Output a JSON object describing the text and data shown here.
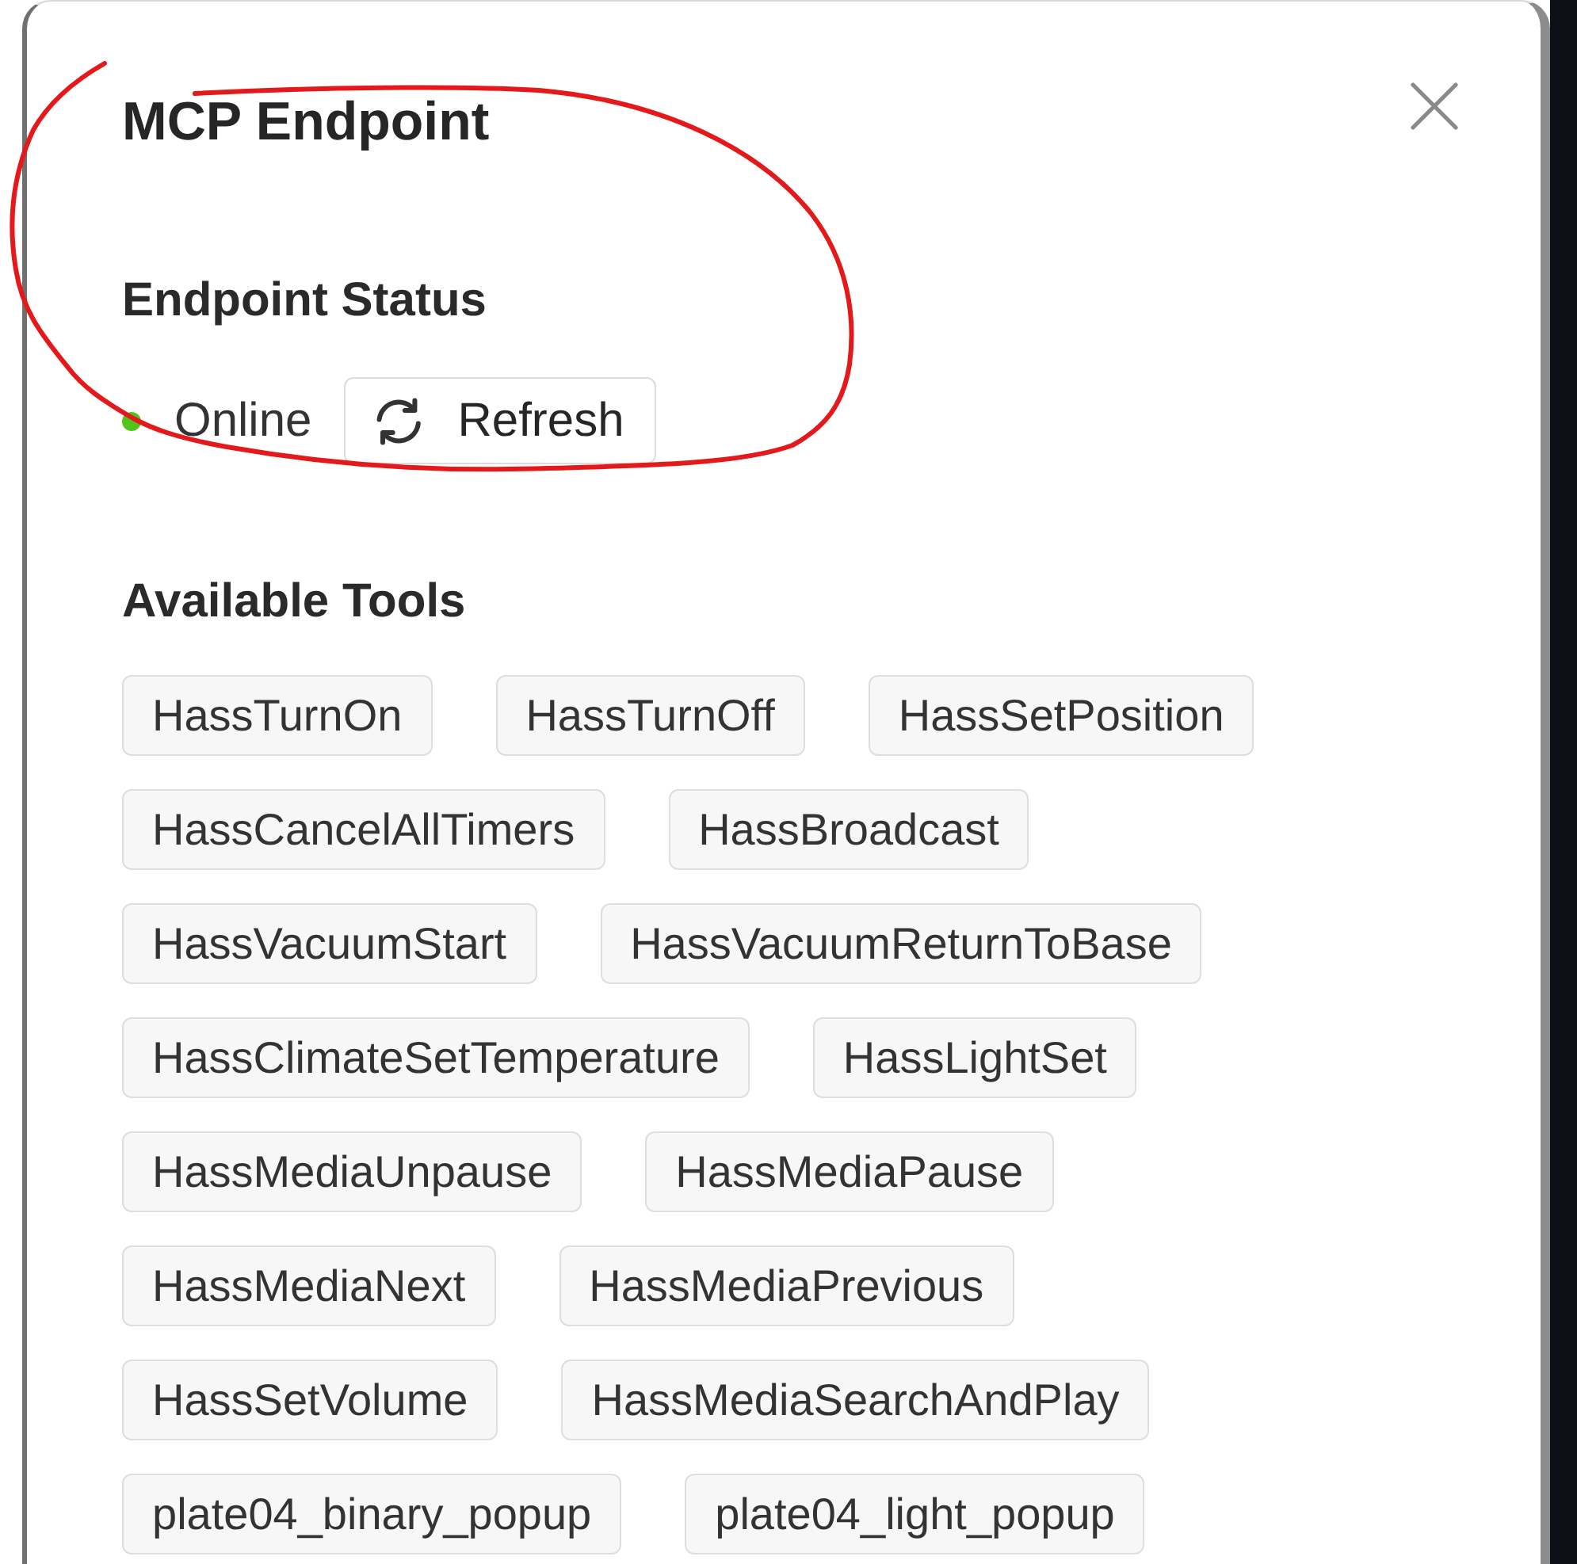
{
  "dialog": {
    "title": "MCP Endpoint"
  },
  "status_section": {
    "heading": "Endpoint Status",
    "status": {
      "label": "Online",
      "color": "#52c41a"
    },
    "refresh_button": {
      "label": "Refresh"
    }
  },
  "tools_section": {
    "heading": "Available Tools",
    "tools": [
      "HassTurnOn",
      "HassTurnOff",
      "HassSetPosition",
      "HassCancelAllTimers",
      "HassBroadcast",
      "HassVacuumStart",
      "HassVacuumReturnToBase",
      "HassClimateSetTemperature",
      "HassLightSet",
      "HassMediaUnpause",
      "HassMediaPause",
      "HassMediaNext",
      "HassMediaPrevious",
      "HassSetVolume",
      "HassMediaSearchAndPlay",
      "plate04_binary_popup",
      "plate04_light_popup"
    ]
  },
  "annotation": {
    "kind": "loop"
  }
}
